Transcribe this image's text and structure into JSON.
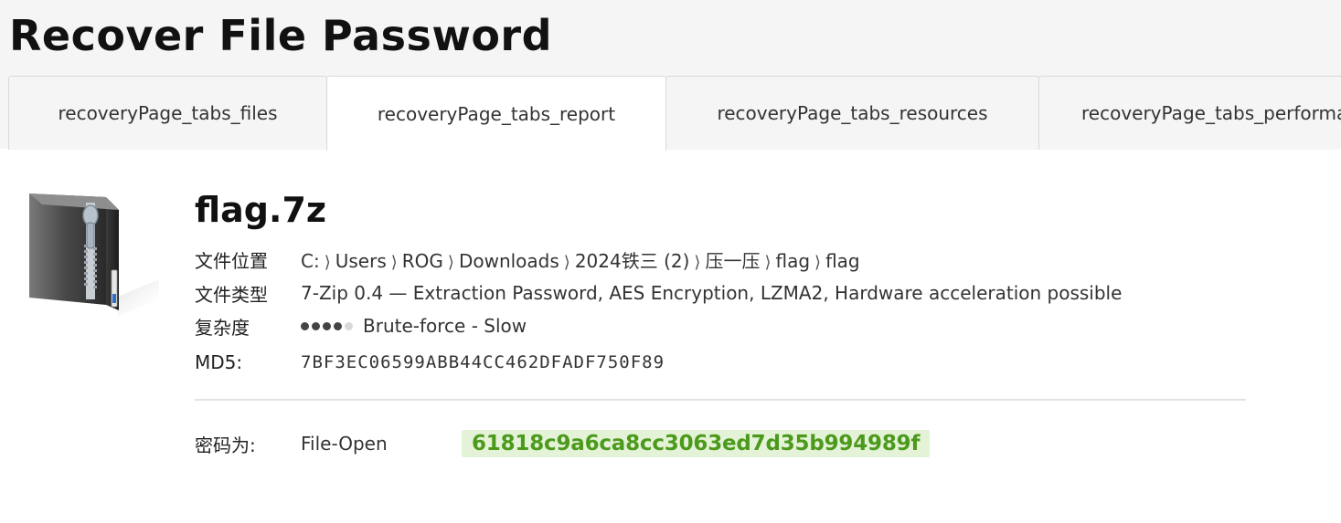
{
  "page": {
    "title": "Recover File Password"
  },
  "tabs": [
    {
      "label": "recoveryPage_tabs_files",
      "active": false
    },
    {
      "label": "recoveryPage_tabs_report",
      "active": true
    },
    {
      "label": "recoveryPage_tabs_resources",
      "active": false
    },
    {
      "label": "recoveryPage_tabs_performance",
      "active": false
    }
  ],
  "file": {
    "icon": "zip-archive-icon",
    "name": "flag.7z",
    "location_label": "文件位置",
    "location_path": [
      "C:",
      "Users",
      "ROG",
      "Downloads",
      "2024铁三 (2)",
      "压一压",
      "flag",
      "flag"
    ],
    "path_separator": "⟩",
    "type_label": "文件类型",
    "type_value": "7-Zip 0.4 — Extraction Password, AES Encryption, LZMA2, Hardware acceleration possible",
    "complexity_label": "复杂度",
    "complexity_level": 4,
    "complexity_max": 5,
    "complexity_text": "Brute-force - Slow",
    "md5_label": "MD5:",
    "md5_value": "7BF3EC06599ABB44CC462DFADF750F89"
  },
  "result": {
    "label": "密码为:",
    "method": "File-Open",
    "password": "61818c9a6ca8cc3063ed7d35b994989f"
  },
  "colors": {
    "password_bg": "#e4f2d8",
    "password_text": "#4c9a1c",
    "tab_bar_bg": "#f5f5f5"
  }
}
